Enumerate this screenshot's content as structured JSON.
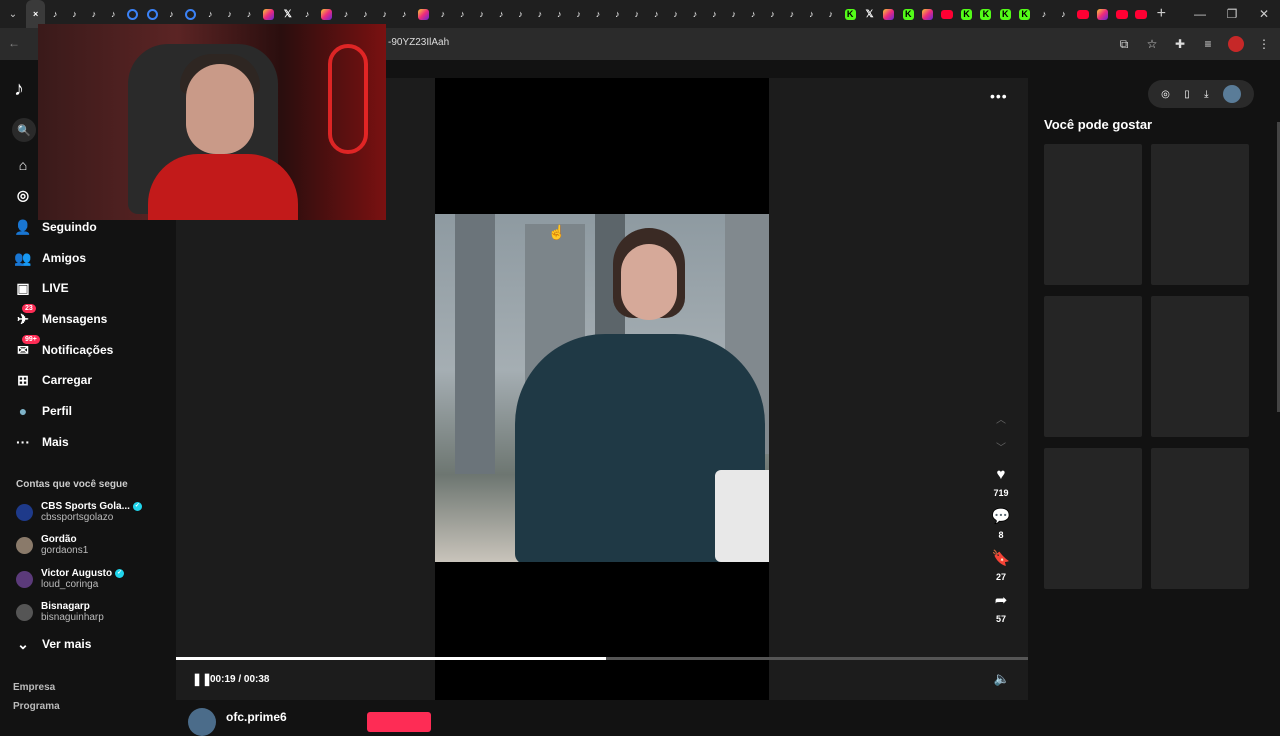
{
  "browser": {
    "tabs": [
      {
        "type": "tiktok",
        "active": true,
        "label": "×"
      },
      {
        "type": "tiktok"
      },
      {
        "type": "tiktok"
      },
      {
        "type": "tiktok"
      },
      {
        "type": "tiktok"
      },
      {
        "type": "ring"
      },
      {
        "type": "ring"
      },
      {
        "type": "tiktok"
      },
      {
        "type": "ring"
      },
      {
        "type": "tiktok"
      },
      {
        "type": "tiktok"
      },
      {
        "type": "tiktok"
      },
      {
        "type": "insta"
      },
      {
        "type": "x"
      },
      {
        "type": "tiktok"
      },
      {
        "type": "insta"
      },
      {
        "type": "tiktok"
      },
      {
        "type": "tiktok"
      },
      {
        "type": "tiktok"
      },
      {
        "type": "tiktok"
      },
      {
        "type": "insta"
      },
      {
        "type": "tiktok"
      },
      {
        "type": "tiktok"
      },
      {
        "type": "tiktok"
      },
      {
        "type": "tiktok"
      },
      {
        "type": "tiktok"
      },
      {
        "type": "tiktok"
      },
      {
        "type": "tiktok"
      },
      {
        "type": "tiktok"
      },
      {
        "type": "tiktok"
      },
      {
        "type": "tiktok"
      },
      {
        "type": "tiktok"
      },
      {
        "type": "tiktok"
      },
      {
        "type": "tiktok"
      },
      {
        "type": "tiktok"
      },
      {
        "type": "tiktok"
      },
      {
        "type": "tiktok"
      },
      {
        "type": "tiktok"
      },
      {
        "type": "tiktok"
      },
      {
        "type": "tiktok"
      },
      {
        "type": "tiktok"
      },
      {
        "type": "tiktok"
      },
      {
        "type": "kick"
      },
      {
        "type": "x"
      },
      {
        "type": "insta"
      },
      {
        "type": "kick"
      },
      {
        "type": "insta"
      },
      {
        "type": "yt"
      },
      {
        "type": "kick"
      },
      {
        "type": "kick"
      },
      {
        "type": "kick"
      },
      {
        "type": "kick"
      },
      {
        "type": "tiktok"
      },
      {
        "type": "tiktok"
      },
      {
        "type": "yt"
      },
      {
        "type": "insta"
      },
      {
        "type": "yt"
      },
      {
        "type": "yt"
      }
    ],
    "address": "-90YZ23IlAah"
  },
  "sidebar": {
    "logo": "♪",
    "items": [
      {
        "label": "Seguindo",
        "icon": "person-follow-icon",
        "glyph": "👤"
      },
      {
        "label": "Amigos",
        "icon": "friends-icon",
        "glyph": "👥"
      },
      {
        "label": "LIVE",
        "icon": "live-icon",
        "glyph": "▣"
      },
      {
        "label": "Mensagens",
        "icon": "messages-icon",
        "glyph": "✈",
        "badge": "23"
      },
      {
        "label": "Notificações",
        "icon": "notifications-icon",
        "glyph": "✉",
        "badge": "99+"
      },
      {
        "label": "Carregar",
        "icon": "upload-icon",
        "glyph": "⊞"
      },
      {
        "label": "Perfil",
        "icon": "profile-avatar-icon",
        "glyph": "●"
      },
      {
        "label": "Mais",
        "icon": "more-icon",
        "glyph": "···"
      }
    ],
    "following_title": "Contas que você segue",
    "following": [
      {
        "name": "CBS Sports Gola...",
        "handle": "cbssportsgolazo",
        "verified": true,
        "color": "#1e3a8a"
      },
      {
        "name": "Gordão",
        "handle": "gordaons1",
        "verified": false,
        "color": "#8a7a6a"
      },
      {
        "name": "Victor Augusto",
        "handle": "loud_coringa",
        "verified": true,
        "color": "#5b3a7a"
      },
      {
        "name": "Bisnagarp",
        "handle": "bisnaguinharp",
        "verified": false,
        "color": "#555555"
      }
    ],
    "see_more": "Ver mais",
    "footer": [
      "Empresa",
      "Programa"
    ]
  },
  "video": {
    "likes": "719",
    "comments": "8",
    "saves": "27",
    "shares": "57",
    "time": "00:19 / 00:38",
    "progress": 0.505,
    "username": "ofc.prime6"
  },
  "right_panel": {
    "title": "Você pode gostar",
    "cards": 6
  },
  "colors": {
    "accent": "#fe2c55",
    "verified": "#20d5ec"
  }
}
